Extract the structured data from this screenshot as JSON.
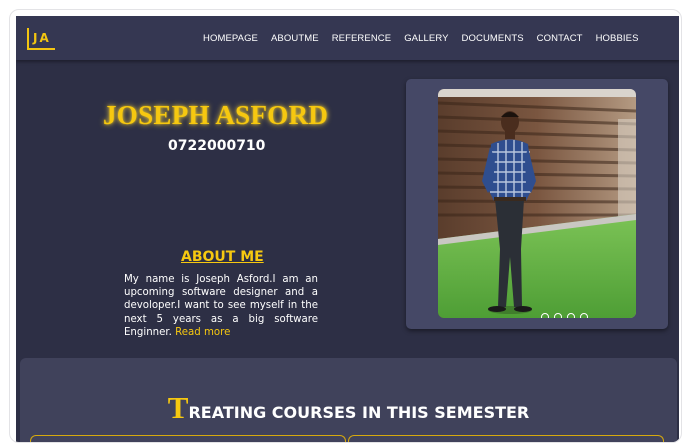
{
  "logo": {
    "text": "JA"
  },
  "nav": {
    "items": [
      "HOMEPAGE",
      "ABOUTME",
      "REFERENCE",
      "GALLERY",
      "DOCUMENTS",
      "CONTACT",
      "HOBBIES"
    ]
  },
  "hero": {
    "name": "JOSEPH ASFORD",
    "phone": "0722000710"
  },
  "about": {
    "title": "ABOUT ME",
    "text": "My name is Joseph Asford.I am an upcoming software designer and a devoloper.I want to see myself in the next 5 years as a big software Enginner.",
    "read_more": "Read more"
  },
  "carousel": {
    "slide_count": 4,
    "active_index": 0
  },
  "courses": {
    "title_cap": "T",
    "title_rest": "REATING COURSES IN THIS SEMESTER"
  },
  "colors": {
    "accent": "#f6c810",
    "background": "#2d2f45",
    "nav": "#353752"
  }
}
